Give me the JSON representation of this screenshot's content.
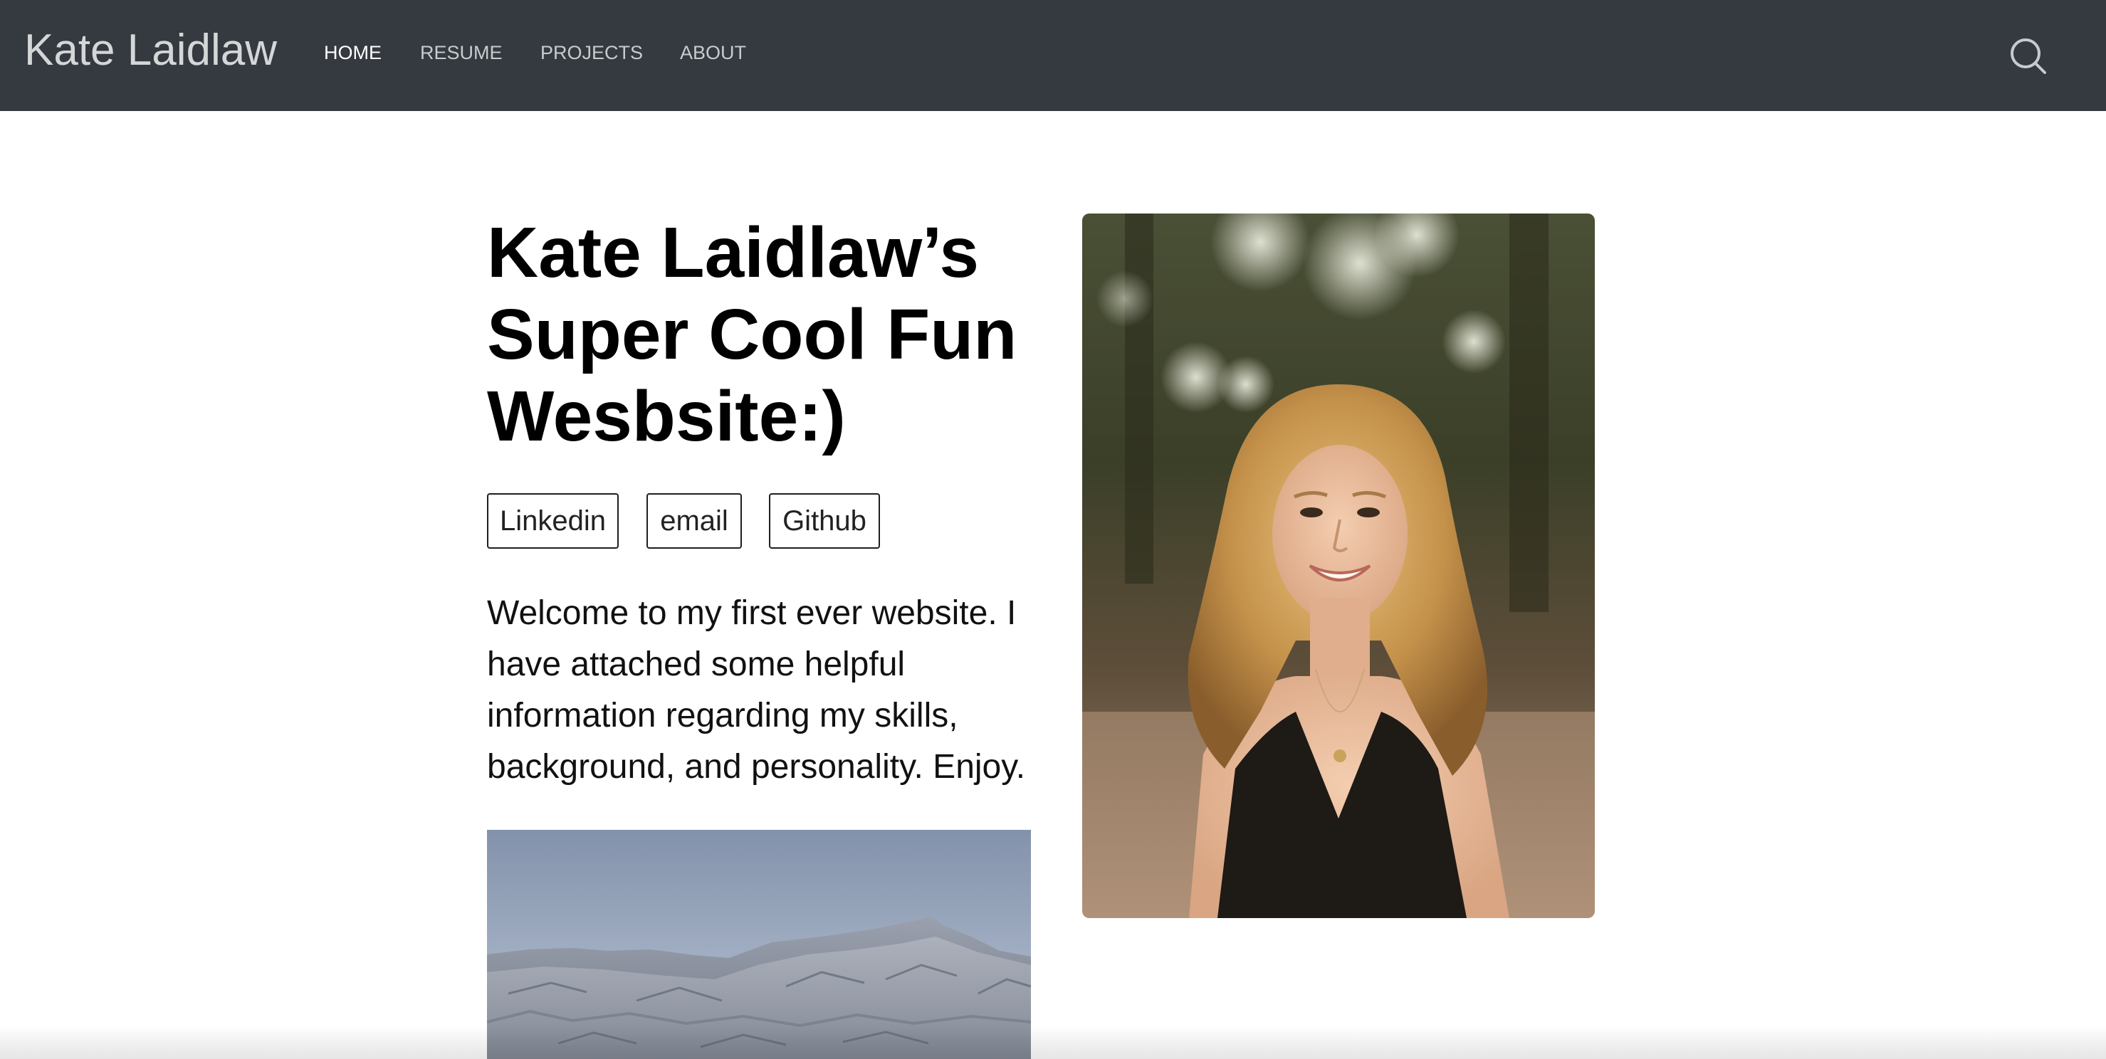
{
  "site": {
    "brand": "Kate Laidlaw"
  },
  "nav": {
    "items": [
      {
        "label": "HOME",
        "active": true
      },
      {
        "label": "RESUME",
        "active": false
      },
      {
        "label": "PROJECTS",
        "active": false
      },
      {
        "label": "ABOUT",
        "active": false
      }
    ],
    "search_icon": "search-icon"
  },
  "hero": {
    "title_lines": [
      "Kate Laidlaw’s",
      "Super Cool Fun",
      "Wesbsite:)"
    ],
    "links": [
      {
        "label": "Linkedin"
      },
      {
        "label": "email"
      },
      {
        "label": "Github"
      }
    ],
    "intro_lines": [
      "Welcome to my first ever website. I",
      "have attached some helpful",
      "information regarding my skills,",
      "background, and personality. Enjoy."
    ]
  },
  "colors": {
    "navbar_bg": "#343a3f",
    "brand_text": "#d4d6d8",
    "nav_text": "#c8cbce",
    "nav_active": "#ffffff",
    "page_bg": "#ffffff"
  }
}
